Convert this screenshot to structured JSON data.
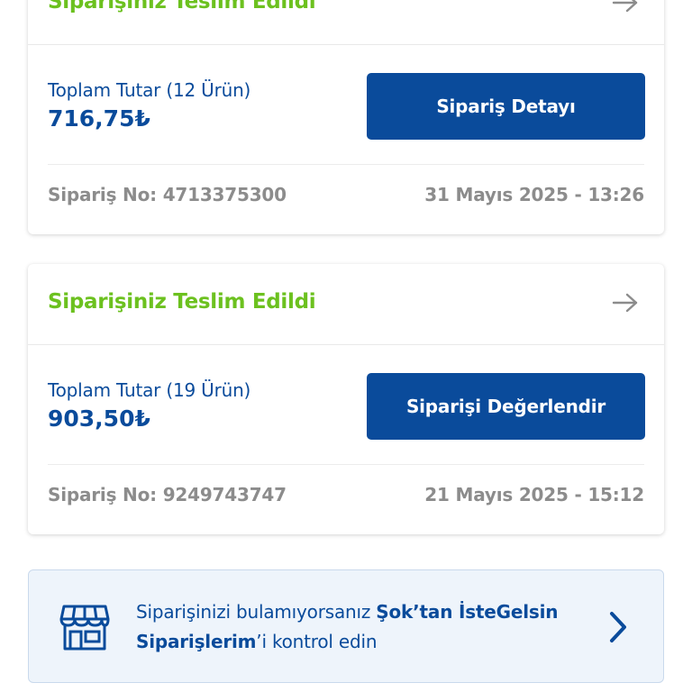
{
  "orders": [
    {
      "status": "Siparişiniz Teslim Edildi",
      "total_label": "Toplam Tutar (12 Ürün)",
      "total_amount": "716,75₺",
      "button_label": "Sipariş Detayı",
      "order_no": "Sipariş No: 4713375300",
      "date": "31 Mayıs 2025 - 13:26"
    },
    {
      "status": "Siparişiniz Teslim Edildi",
      "total_label": "Toplam Tutar (19 Ürün)",
      "total_amount": "903,50₺",
      "button_label": "Siparişi Değerlendir",
      "order_no": "Sipariş No: 9249743747",
      "date": "21 Mayıs 2025 - 15:12"
    }
  ],
  "banner": {
    "text_prefix": "Siparişinizi bulamıyorsanız ",
    "text_bold_1": "Şok’tan İsteGelsin Siparişlerim",
    "text_suffix": "’i kontrol edin"
  },
  "icons": {
    "arrow": "arrow-right-icon",
    "store": "store-icon",
    "chevron": "chevron-right-icon"
  },
  "colors": {
    "status_green": "#6cc11f",
    "brand_blue": "#0a4b9b",
    "muted_gray": "#8c8c8c",
    "banner_bg": "#eef4fb"
  }
}
